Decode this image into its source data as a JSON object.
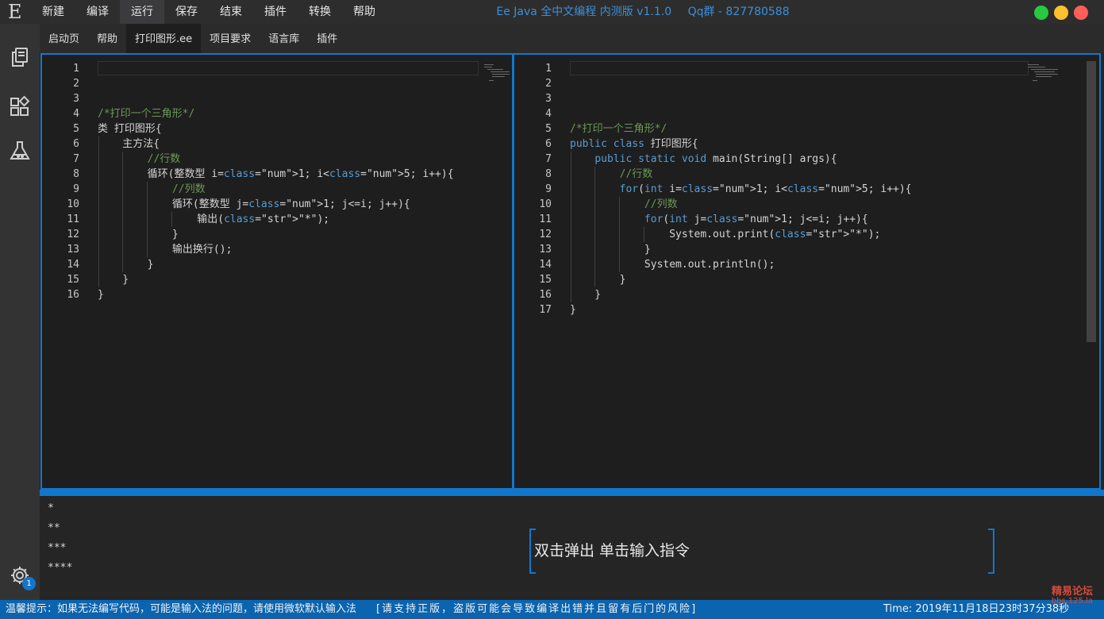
{
  "app": {
    "logo": "E",
    "title": "Ee Java 全中文编程 内测版 v1.1.0",
    "qq": "Qq群 - 827780588"
  },
  "menu": [
    "新建",
    "编译",
    "运行",
    "保存",
    "结束",
    "插件",
    "转换",
    "帮助"
  ],
  "active_menu_index": 2,
  "window_buttons": [
    {
      "name": "maximize",
      "color": "#28c840"
    },
    {
      "name": "minimize",
      "color": "#fec02f"
    },
    {
      "name": "close",
      "color": "#ff5f57"
    }
  ],
  "tabs": [
    "启动页",
    "帮助",
    "打印图形.ee",
    "项目要求",
    "语言库",
    "插件"
  ],
  "active_tab_index": 2,
  "activity_icons": [
    "explorer-icon",
    "extensions-icon",
    "flask-icon",
    "settings-icon"
  ],
  "settings_badge": "1",
  "editor_left": {
    "line_numbers": [
      "1",
      "2",
      "3",
      "4",
      "5",
      "6",
      "7",
      "8",
      "9",
      "10",
      "11",
      "12",
      "13",
      "14",
      "15",
      "16"
    ],
    "lines": [
      "",
      "",
      "",
      "/*打印一个三角形*/",
      "类 打印图形{",
      "    主方法{",
      "        //行数",
      "        循环(整数型 i=1; i<5; i++){",
      "            //列数",
      "            循环(整数型 j=1; j<=i; j++){",
      "                输出(\"*\");",
      "            }",
      "            输出换行();",
      "        }",
      "    }",
      "}"
    ]
  },
  "editor_right": {
    "line_numbers": [
      "1",
      "2",
      "3",
      "4",
      "5",
      "6",
      "7",
      "8",
      "9",
      "10",
      "11",
      "12",
      "13",
      "14",
      "15",
      "16",
      "17"
    ],
    "lines": [
      "",
      "",
      "",
      "",
      "/*打印一个三角形*/",
      "public class 打印图形{",
      "    public static void main(String[] args){",
      "        //行数",
      "        for(int i=1; i<5; i++){",
      "            //列数",
      "            for(int j=1; j<=i; j++){",
      "                System.out.print(\"*\");",
      "            }",
      "            System.out.println();",
      "        }",
      "    }",
      "}"
    ]
  },
  "console": {
    "output": [
      "*",
      "**",
      "***",
      "****"
    ],
    "command_hint": "双击弹出 单击输入指令"
  },
  "status": {
    "tip": "温馨提示：如果无法编写代码，可能是输入法的问题，请使用微软默认输入法",
    "warning": "[请支持正版，盗版可能会导致编译出错并且留有后门的风险]",
    "time": "Time: 2019年11月18日23时37分38秒"
  },
  "watermark": {
    "line1": "精易论坛",
    "line2": "bbs.125.la"
  },
  "colors": {
    "accent": "#1177cc",
    "keyword": "#569cd6",
    "comment": "#6a9955",
    "number": "#b5cea8",
    "string": "#ce9178",
    "editor_bg": "#1e1e1e"
  }
}
